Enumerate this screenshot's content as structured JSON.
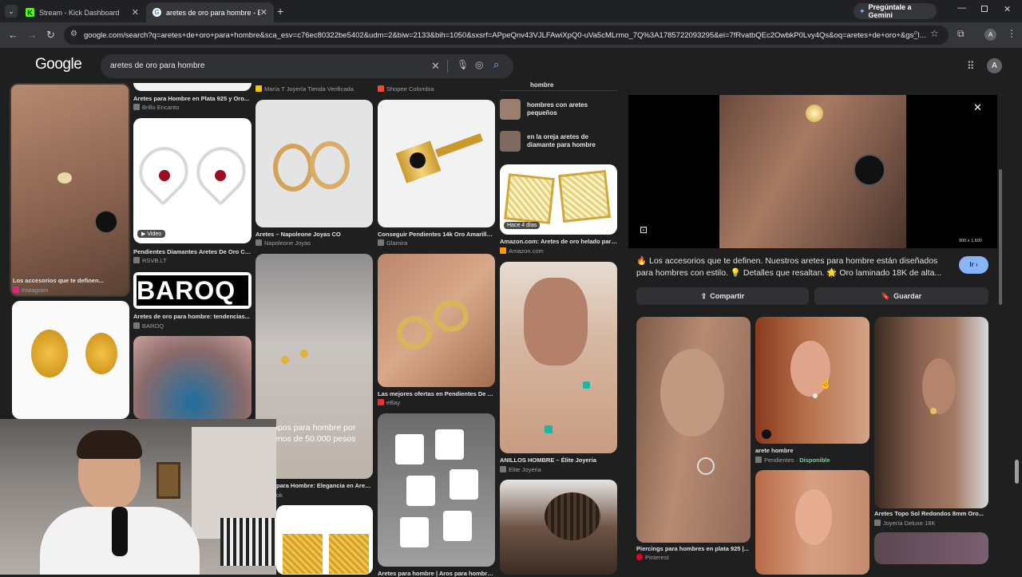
{
  "tabs": [
    {
      "label": "Stream - Kick Dashboard"
    },
    {
      "label": "aretes de oro para hombre - Bú"
    }
  ],
  "gemini_button": "Pregúntale a Gemini",
  "url": "google.com/search?q=aretes+de+oro+para+hombre&sca_esv=c76ec80322be5402&udm=2&biw=2133&bih=1050&sxsrf=APpeQnv43VJLFAwiXpQ0-uVa5cMLrmo_7Q%3A1785722093295&ei=7fRvatbQEc2OwbkP0Lvy4Qs&oq=aretes+de+oro+&gs_l...",
  "profile_initial": "A",
  "logo": "Google",
  "search": {
    "query": "aretes de oro para hombre"
  },
  "results": {
    "col1": [
      {
        "caption": "Los accesorios que te definen...",
        "source": "Instagram"
      },
      {
        "caption": "",
        "source": ""
      }
    ],
    "col2": [
      {
        "caption": "Aretes para Hombre en Plata 925 y Oro...",
        "source": "Brillo Encanto"
      },
      {
        "caption": "Pendientes Diamantes Aretes De Oro Co...",
        "source": "RSVB.LT",
        "badge": "Video"
      },
      {
        "caption": "Aretes de oro para hombre: tendencias...",
        "source": "BAROQ",
        "banner": "BAROQ"
      }
    ],
    "col3": [
      {
        "caption": "",
        "source": "María T Joyería Tienda Verificada"
      },
      {
        "caption": "Aretes – Napoleone Joyas CO",
        "source": "Napoleone Joyas"
      },
      {
        "caption": "para Hombre: Elegancia en Arete...",
        "source": "ok",
        "overlay1": "opos para hombre por",
        "overlay2": "enos de 50.000 pesos"
      }
    ],
    "col4": [
      {
        "caption": "",
        "source": "Shopee Colombia"
      },
      {
        "caption": "Conseguir Pendientes 14k Oro Amarillo...",
        "source": "Glamira"
      },
      {
        "caption": "Las mejores ofertas en Pendientes De A...",
        "source": "eBay"
      },
      {
        "caption": "Aretes para hombre | Aros para hombre...",
        "source": ""
      }
    ],
    "col5_suggestions": [
      {
        "label": "hombre"
      },
      {
        "label": "hombres con aretes pequeños"
      },
      {
        "label": "en la oreja aretes de diamante para hombre"
      }
    ],
    "col5": [
      {
        "caption": "Amazon.com: Aretes de oro helado para...",
        "source": "Amazon.com",
        "badge": "Hace 4 días"
      },
      {
        "caption": "ANILLOS HOMBRE – Élite Joyeria",
        "source": "Elite Joyeria"
      }
    ]
  },
  "panel": {
    "dimensions": "900 x 1,600",
    "description": "🔥 Los accesorios que te definen. Nuestros aretes para hombre están diseñados para hombres con estilo. 💡 Detalles que resaltan. 🌟 Oro laminado 18K de alta...",
    "go": "Ir",
    "share": "Compartir",
    "save": "Guardar",
    "related": [
      {
        "caption": "Piercings para hombres en plata 925 |...",
        "source": "Pinterest"
      },
      {
        "caption": "arete hombre",
        "source": "Pendientes · ",
        "status": "Disponible"
      },
      {
        "caption": "Aretes Topo Sol Redondos 8mm Oro...",
        "source": "Joyería Deluxe 18K"
      }
    ]
  },
  "colors": {
    "accent": "#8ab4f8",
    "available": "#81c995",
    "background": "#1f1f1f"
  }
}
